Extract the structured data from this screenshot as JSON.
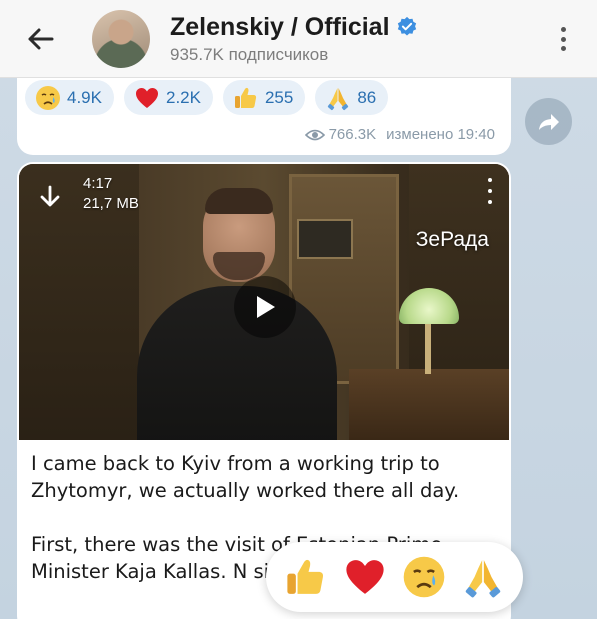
{
  "header": {
    "title": "Zelenskiy / Official",
    "subscribers": "935.7K подписчиков"
  },
  "previous_message": {
    "reactions": [
      {
        "emoji": "crying-face",
        "count": "4.9K"
      },
      {
        "emoji": "red-heart",
        "count": "2.2K"
      },
      {
        "emoji": "thumbs-up",
        "count": "255"
      },
      {
        "emoji": "folded-hands",
        "count": "86"
      }
    ],
    "views": "766.3K",
    "edited": "изменено 19:40"
  },
  "video": {
    "duration": "4:17",
    "size": "21,7 MB",
    "watermark": "ЗеРада"
  },
  "message": {
    "paragraphs": [
      "I came back to Kyiv from a working trip to Zhytomyr, we actually worked there all day.",
      "First, there was the visit of Estonian Prime Minister Kaja Kallas. N signing of the Joint Dec"
    ]
  },
  "reaction_picker": {
    "emojis": [
      "thumbs-up",
      "red-heart",
      "crying-face",
      "folded-hands"
    ]
  },
  "colors": {
    "accent": "#2a6fb0",
    "verified": "#3d8fe0",
    "header_bg": "#f7f7f7",
    "reaction_pill_bg": "#e8f0f8"
  }
}
